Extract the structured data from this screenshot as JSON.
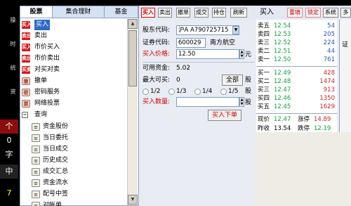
{
  "left_strip": {
    "vtexts": [
      "操",
      "时",
      "统",
      "资"
    ],
    "chars": [
      "个",
      "0",
      "字",
      "中",
      "7"
    ]
  },
  "left_panel": {
    "tabs": [
      "股票",
      "集合理财",
      "基金"
    ],
    "items": [
      {
        "label": "买入",
        "icon": "买入",
        "selected": true
      },
      {
        "label": "卖出",
        "icon": "卖出"
      },
      {
        "label": "市价买入",
        "icon": "买入"
      },
      {
        "label": "市价卖出",
        "icon": "卖出"
      },
      {
        "label": "对买对卖",
        "icon": "买卖"
      },
      {
        "label": "撤单",
        "icon": "撤"
      },
      {
        "label": "密码服务",
        "icon": "密"
      },
      {
        "label": "网络投票",
        "icon": "票"
      },
      {
        "label": "查询",
        "icon": "−"
      }
    ],
    "query_items": [
      "资金股份",
      "当日委托",
      "当日成交",
      "历史成交",
      "成交汇总",
      "资金流水",
      "配号中签",
      "对帐单"
    ]
  },
  "toolbar": {
    "buttons": [
      "买入",
      "卖出",
      "撤单",
      "成交",
      "持仓",
      "刷新"
    ],
    "title": "买入",
    "right_buttons": [
      "重填",
      "锁定",
      "系统",
      "多帐"
    ]
  },
  "form": {
    "account_label": "股东代码:",
    "account_value": "沪A A790725715",
    "code_label": "证券代码:",
    "code_value": "600029",
    "stock_name": "南方航空",
    "price_label": "买入价格:",
    "price_value": "12.50",
    "price_unit": "元",
    "funds_label": "可用资金:",
    "funds_value": "5.02",
    "max_label": "最大可买:",
    "max_value": "0",
    "all_button": "全部",
    "shares_unit": "股",
    "radios": [
      "1/2",
      "1/3",
      "1/4",
      "1/5"
    ],
    "qty_label": "买入数量:",
    "qty_value": "",
    "qty_unit": "股",
    "submit": "买入下单"
  },
  "quote": {
    "sells": [
      {
        "label": "卖五",
        "price": "12.54",
        "vol": "54"
      },
      {
        "label": "卖四",
        "price": "12.53",
        "vol": "205"
      },
      {
        "label": "卖三",
        "price": "12.52",
        "vol": "224"
      },
      {
        "label": "卖二",
        "price": "12.51",
        "vol": "44"
      },
      {
        "label": "卖一",
        "price": "12.50",
        "vol": "761"
      }
    ],
    "buys": [
      {
        "label": "买一",
        "price": "12.49",
        "vol": "428"
      },
      {
        "label": "买二",
        "price": "12.48",
        "vol": "1474"
      },
      {
        "label": "买三",
        "price": "12.47",
        "vol": "913"
      },
      {
        "label": "买四",
        "price": "12.46",
        "vol": "1350"
      },
      {
        "label": "买五",
        "price": "12.45",
        "vol": "1629"
      }
    ],
    "current_label": "现价",
    "current": "12.47",
    "limit_up_label": "涨停",
    "limit_up": "14.89",
    "prev_close_label": "昨收",
    "prev_close": "13.54",
    "limit_down_label": "跌停",
    "limit_down": "12.19"
  },
  "right_stub": "证"
}
